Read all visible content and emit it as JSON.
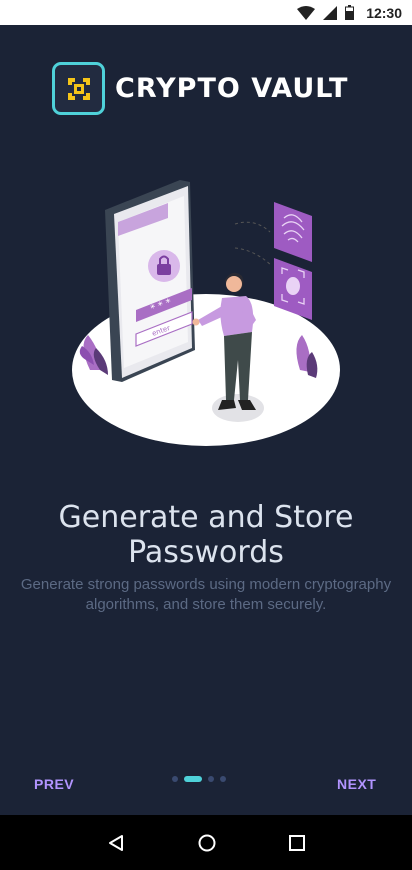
{
  "status_bar": {
    "time": "12:30",
    "icons": [
      "wifi-icon",
      "signal-icon",
      "battery-icon"
    ]
  },
  "app": {
    "brand": "CRYPTO VAULT",
    "accent_color": "#4fd1d9",
    "logo_icon": "vault-emblem-icon",
    "background_color": "#1b2336"
  },
  "slide": {
    "headline": "Generate and Store Passwords",
    "body": "Generate strong passwords using modern cryptography algorithms, and store them securely.",
    "illustration": "person-unlocking-phone-illustration",
    "illustration_field_text": "enter"
  },
  "pager": {
    "prev_label": "PREV",
    "next_label": "NEXT",
    "page_count": 4,
    "current_page": 2,
    "active_dot_color": "#4fd1d9",
    "button_color": "#b294ff"
  },
  "system_nav": {
    "icons": [
      "back-icon",
      "home-icon",
      "recents-icon"
    ]
  }
}
